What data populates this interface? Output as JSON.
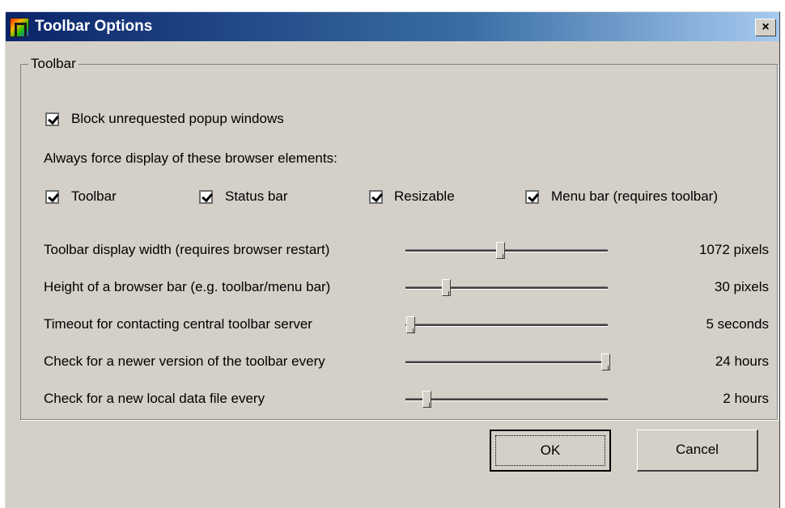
{
  "window": {
    "title": "Toolbar Options",
    "close_glyph": "×"
  },
  "groupbox": {
    "label": "Toolbar"
  },
  "block_popups": {
    "label": "Block unrequested popup windows",
    "checked": true
  },
  "force_display": {
    "heading": "Always force display of these browser elements:",
    "items": [
      {
        "label": "Toolbar",
        "checked": true
      },
      {
        "label": "Status bar",
        "checked": true
      },
      {
        "label": "Resizable",
        "checked": true
      },
      {
        "label": "Menu bar (requires toolbar)",
        "checked": true
      }
    ]
  },
  "sliders": [
    {
      "label": "Toolbar display width (requires browser restart)",
      "value": "1072",
      "unit": "pixels",
      "fraction": 0.47
    },
    {
      "label": "Height of a browser bar (e.g. toolbar/menu bar)",
      "value": "30",
      "unit": "pixels",
      "fraction": 0.2
    },
    {
      "label": "Timeout for contacting central toolbar server",
      "value": "5",
      "unit": "seconds",
      "fraction": 0.02
    },
    {
      "label": "Check for a newer version of the toolbar every",
      "value": "24",
      "unit": "hours",
      "fraction": 1.0
    },
    {
      "label": "Check for a new local data file every",
      "value": "2",
      "unit": "hours",
      "fraction": 0.1
    }
  ],
  "buttons": {
    "ok": "OK",
    "cancel": "Cancel"
  },
  "colors": {
    "titlebar_start": "#0a246a",
    "titlebar_end": "#a6caf0",
    "face": "#d4d0c8"
  }
}
